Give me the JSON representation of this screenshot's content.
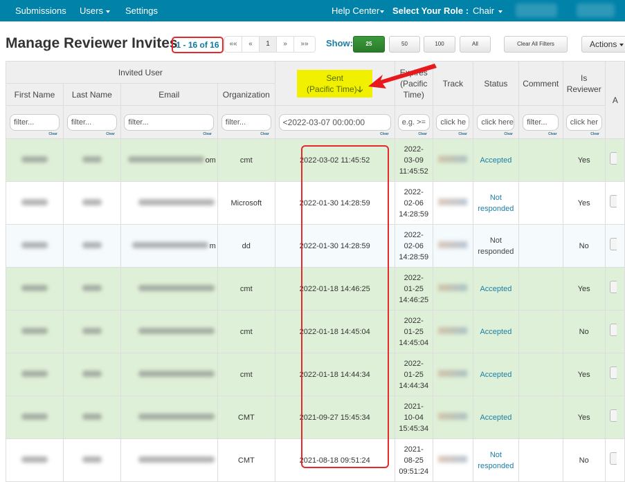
{
  "navbar": {
    "left_items": [
      "Submissions",
      "Users",
      "Settings"
    ],
    "help_center": "Help Center",
    "role_label": "Select Your Role :",
    "role_value": "Chair"
  },
  "page": {
    "title": "Manage Reviewer Invites",
    "count": "1 - 16 of 16"
  },
  "pager": {
    "first": "««",
    "prev": "«",
    "current": "1",
    "next": "»",
    "last": "»»"
  },
  "show": {
    "label": "Show:",
    "options": [
      "25",
      "50",
      "100",
      "All"
    ],
    "selected": "25"
  },
  "toolbar": {
    "clear_filters": "Clear All Filters",
    "actions": "Actions"
  },
  "table": {
    "group_header": "Invited User",
    "columns": {
      "first_name": "First Name",
      "last_name": "Last Name",
      "email": "Email",
      "organization": "Organization",
      "sent_line1": "Sent",
      "sent_line2": "(Pacific Time)",
      "expires_line1": "Expires",
      "expires_line2": "(Pacific",
      "expires_line3": "Time)",
      "track": "Track",
      "status": "Status",
      "comment": "Comment",
      "is_reviewer_line1": "Is",
      "is_reviewer_line2": "Reviewer"
    },
    "filters": {
      "first_name": "filter...",
      "last_name": "filter...",
      "email": "filter...",
      "organization": "filter...",
      "sent": "<2022-03-07 00:00:00",
      "expires": "e.g. >=",
      "track": "click he",
      "status": "click here",
      "comment": "filter...",
      "is_reviewer": "click her",
      "clear_label": "Clear"
    },
    "sort": {
      "column": "sent",
      "direction": "descending"
    },
    "rows": [
      {
        "organization": "cmt",
        "sent": "2022-03-02 11:45:52",
        "expires_date": "2022-",
        "expires_md": "03-09",
        "expires_time": "11:45:52",
        "status": "Accepted",
        "status_link": true,
        "comment": "",
        "is_reviewer": "Yes",
        "style": "green",
        "email_suffix": "om"
      },
      {
        "organization": "Microsoft",
        "sent": "2022-01-30 14:28:59",
        "expires_date": "2022-",
        "expires_md": "02-06",
        "expires_time": "14:28:59",
        "status": "Not responded",
        "status_link": true,
        "comment": "",
        "is_reviewer": "Yes",
        "style": "white",
        "email_suffix": ""
      },
      {
        "organization": "dd",
        "sent": "2022-01-30 14:28:59",
        "expires_date": "2022-",
        "expires_md": "02-06",
        "expires_time": "14:28:59",
        "status": "Not responded",
        "status_link": false,
        "comment": "",
        "is_reviewer": "No",
        "style": "light",
        "email_suffix": "m"
      },
      {
        "organization": "cmt",
        "sent": "2022-01-18 14:46:25",
        "expires_date": "2022-",
        "expires_md": "01-25",
        "expires_time": "14:46:25",
        "status": "Accepted",
        "status_link": true,
        "comment": "",
        "is_reviewer": "Yes",
        "style": "green",
        "email_suffix": ""
      },
      {
        "organization": "cmt",
        "sent": "2022-01-18 14:45:04",
        "expires_date": "2022-",
        "expires_md": "01-25",
        "expires_time": "14:45:04",
        "status": "Accepted",
        "status_link": true,
        "comment": "",
        "is_reviewer": "No",
        "style": "green",
        "email_suffix": ""
      },
      {
        "organization": "cmt",
        "sent": "2022-01-18 14:44:34",
        "expires_date": "2022-",
        "expires_md": "01-25",
        "expires_time": "14:44:34",
        "status": "Accepted",
        "status_link": true,
        "comment": "",
        "is_reviewer": "Yes",
        "style": "green",
        "email_suffix": ""
      },
      {
        "organization": "CMT",
        "sent": "2021-09-27 15:45:34",
        "expires_date": "2021-",
        "expires_md": "10-04",
        "expires_time": "15:45:34",
        "status": "Accepted",
        "status_link": true,
        "comment": "",
        "is_reviewer": "Yes",
        "style": "green",
        "email_suffix": ""
      },
      {
        "organization": "CMT",
        "sent": "2021-08-18 09:51:24",
        "expires_date": "2021-",
        "expires_md": "08-25",
        "expires_time": "09:51:24",
        "status": "Not responded",
        "status_link": true,
        "comment": "",
        "is_reviewer": "No",
        "style": "white",
        "email_suffix": ""
      }
    ]
  },
  "colors": {
    "navbar_bg": "#0082a9",
    "accent_link": "#1a7ea6",
    "accepted_row_bg": "#dff0d8",
    "highlight_yellow": "#f0f000",
    "annotation_red": "#e5282b",
    "selected_show_green": "#2e8b2e"
  }
}
